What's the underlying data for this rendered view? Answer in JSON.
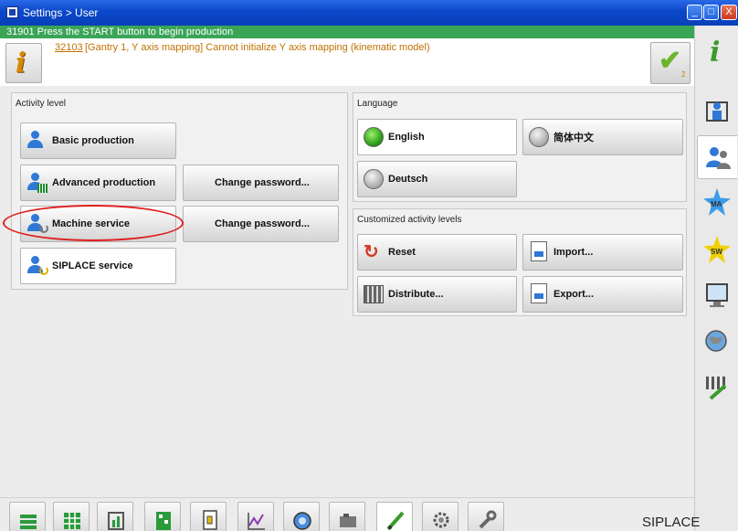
{
  "window": {
    "title": "Settings > User",
    "min": "_",
    "max": "□",
    "close": "X"
  },
  "status": {
    "text": "31901 Press the START button to begin production",
    "color": "#3aa457"
  },
  "message": {
    "code": "32103",
    "text": "[Gantry 1, Y axis mapping] Cannot initialize Y axis mapping (kinematic model)",
    "ack_count": "2",
    "info_icon": "i",
    "check_icon": "✔"
  },
  "activity": {
    "title": "Activity level",
    "basic": "Basic production",
    "advanced": "Advanced production",
    "machine": "Machine service",
    "siplace": "SIPLACE service",
    "change_pw_1": "Change password...",
    "change_pw_2": "Change password..."
  },
  "language": {
    "title": "Language",
    "english": "English",
    "chinese": "简体中文",
    "deutsch": "Deutsch"
  },
  "custom": {
    "title": "Customized activity levels",
    "reset": "Reset",
    "import": "Import...",
    "distribute": "Distribute...",
    "export": "Export..."
  },
  "sidebar": {
    "info_glyph": "i",
    "ma_label": "MA",
    "sw_label": "SW"
  },
  "brand": "SIPLACE",
  "colors": {
    "accent_green": "#3aa457",
    "title_blue": "#0a47c8",
    "message_orange": "#c07000",
    "highlight_red": "#e02020"
  }
}
